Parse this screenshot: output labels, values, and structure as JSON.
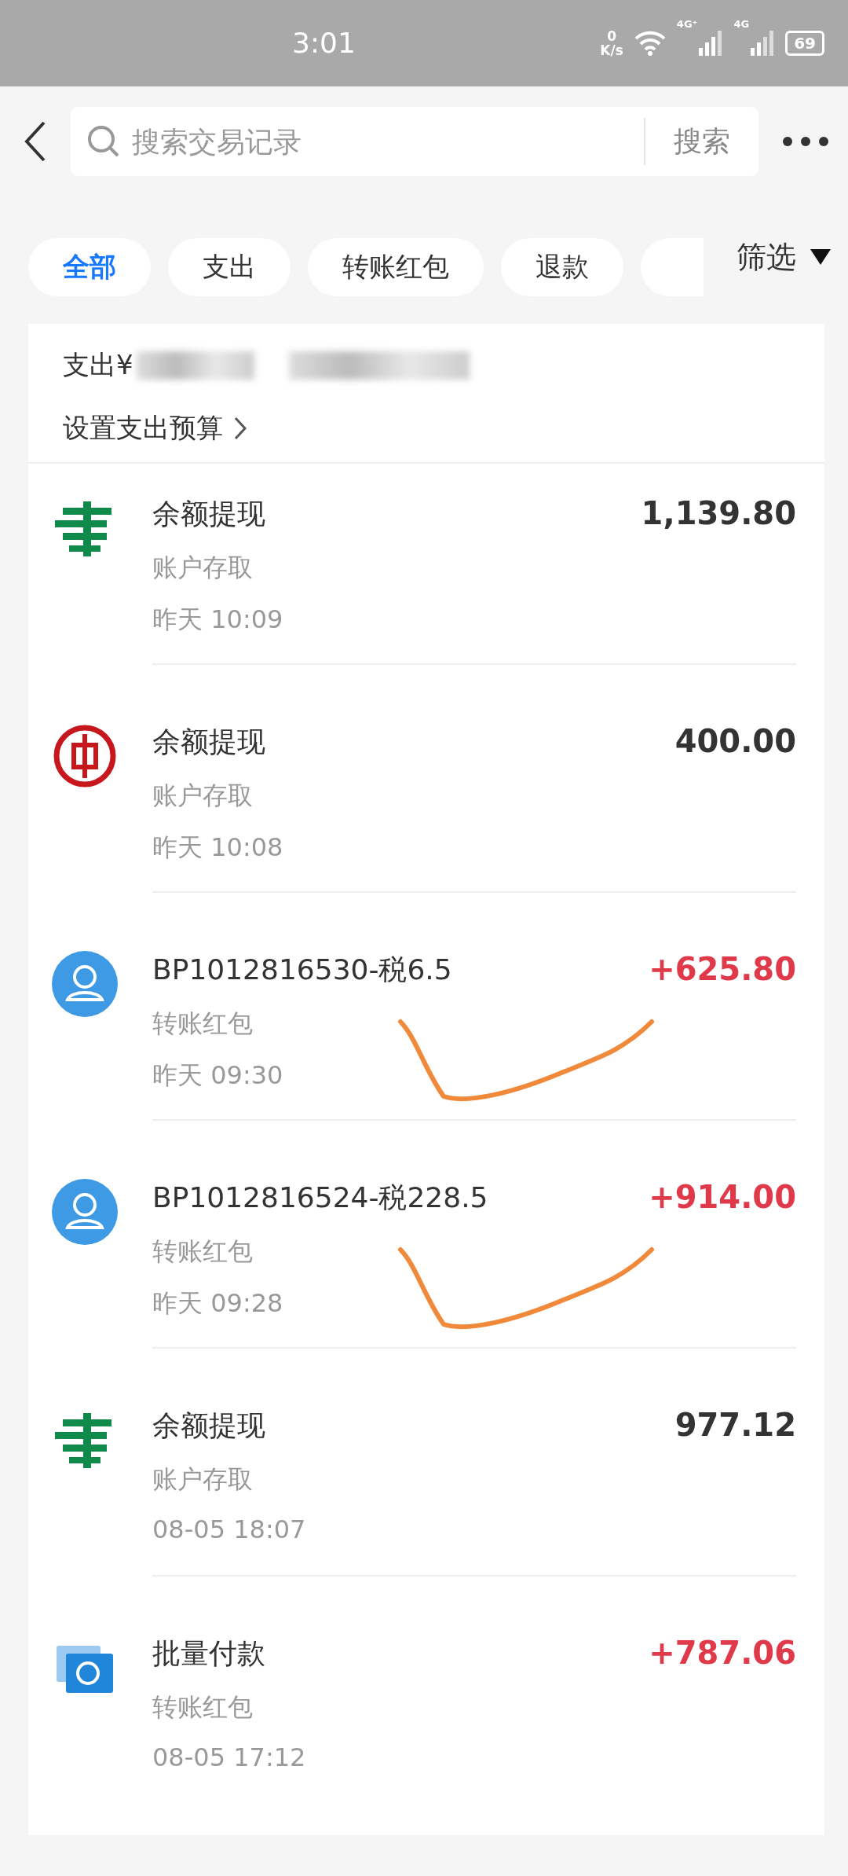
{
  "status_bar": {
    "time": "3:01",
    "net_speed_value": "0",
    "net_speed_unit": "K/s",
    "network_1": "4G⁺",
    "network_2": "4G",
    "battery": "69"
  },
  "header": {
    "search": {
      "placeholder": "搜索交易记录"
    },
    "search_button": "搜索"
  },
  "filters": [
    {
      "label": "全部",
      "selected": true
    },
    {
      "label": "支出",
      "selected": false
    },
    {
      "label": "转账红包",
      "selected": false
    },
    {
      "label": "退款",
      "selected": false
    }
  ],
  "filter_menu": "筛选",
  "summary": {
    "label": "支出¥",
    "budget_link": "设置支出预算"
  },
  "transactions": [
    {
      "kind": "postal",
      "title": "余额提现",
      "category": "账户存取",
      "time": "昨天 10:09",
      "amount": "1,139.80",
      "income": false,
      "scribbled": false
    },
    {
      "kind": "bank",
      "title": "余额提现",
      "category": "账户存取",
      "time": "昨天 10:08",
      "amount": "400.00",
      "income": false,
      "scribbled": false
    },
    {
      "kind": "avatar",
      "title": "BP1012816530-税6.5",
      "category": "转账红包",
      "time": "昨天 09:30",
      "amount": "+625.80",
      "income": true,
      "scribbled": true
    },
    {
      "kind": "avatar",
      "title": "BP1012816524-税228.5",
      "category": "转账红包",
      "time": "昨天 09:28",
      "amount": "+914.00",
      "income": true,
      "scribbled": true
    },
    {
      "kind": "postal",
      "title": "余额提现",
      "category": "账户存取",
      "time": "08-05 18:07",
      "amount": "977.12",
      "income": false,
      "scribbled": false
    },
    {
      "kind": "batch",
      "title": "批量付款",
      "category": "转账红包",
      "time": "08-05 17:12",
      "amount": "+787.06",
      "income": true,
      "scribbled": false
    }
  ]
}
